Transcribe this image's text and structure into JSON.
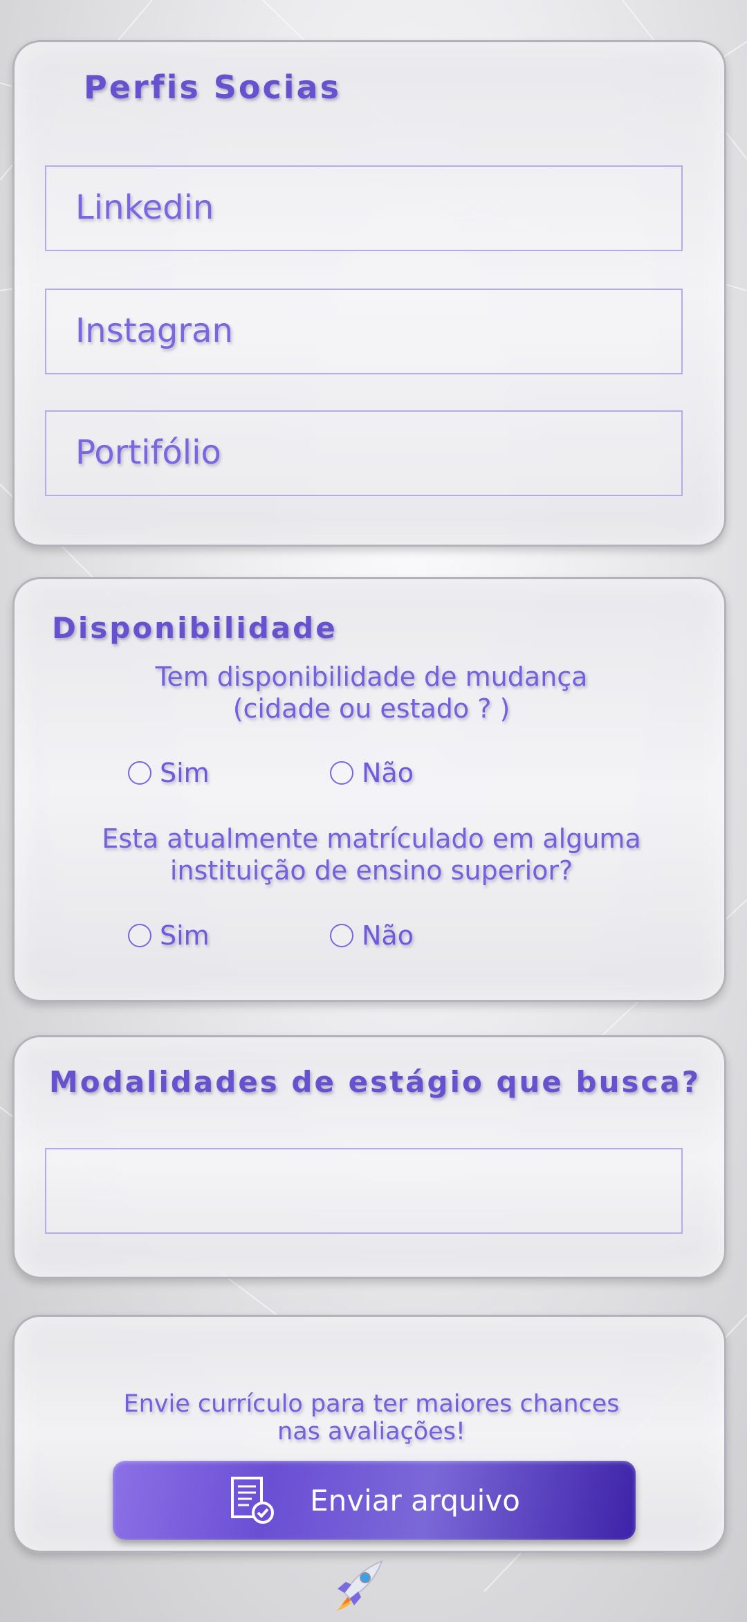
{
  "profiles": {
    "title": "Perfis Socias",
    "fields": [
      {
        "placeholder": "Linkedin"
      },
      {
        "placeholder": "Instagran"
      },
      {
        "placeholder": "Portifólio"
      }
    ]
  },
  "availability": {
    "title": "Disponibilidade",
    "q1_line1": "Tem disponibilidade de mudança",
    "q1_line2": "(cidade ou estado ? )",
    "q1_options": [
      "Sim",
      "Não"
    ],
    "q2_line1": "Esta atualmente matrículado em alguma",
    "q2_line2": "instituição de ensino superior?",
    "q2_options": [
      "Sim",
      "Não"
    ]
  },
  "modalities": {
    "title": "Modalidades de estágio que busca?",
    "value": ""
  },
  "upload": {
    "note_line1": "Envie currículo para ter maiores chances",
    "note_line2": "nas avaliações!",
    "button_label": "Enviar arquivo",
    "button_icon": "document-check-icon"
  },
  "footer": {
    "icon": "rocket-icon"
  },
  "colors": {
    "accent": "#6a55d8",
    "button_start": "#8b70e6",
    "button_end": "#3d22a8"
  }
}
